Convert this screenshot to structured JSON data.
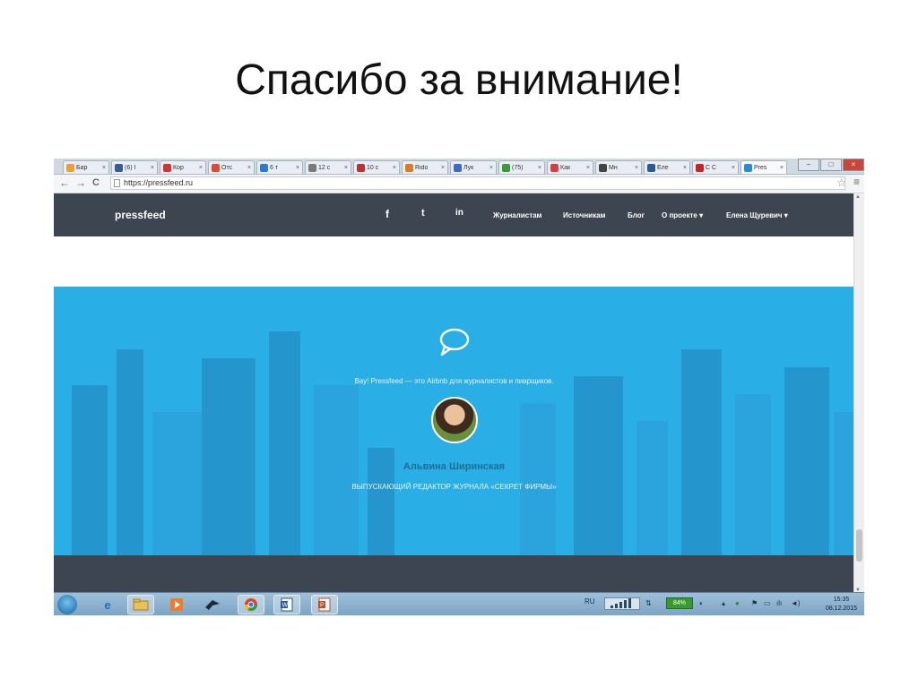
{
  "slide": {
    "title": "Спасибо за внимание!"
  },
  "browser": {
    "tabs": [
      {
        "label": "Бар",
        "color": "#f0a030"
      },
      {
        "label": "(6) I",
        "color": "#3b5998"
      },
      {
        "label": "Кор",
        "color": "#d9342b"
      },
      {
        "label": "Отс",
        "color": "#e04a2a"
      },
      {
        "label": "6 т",
        "color": "#2a7ad9"
      },
      {
        "label": "12 с",
        "color": "#7a7a7a"
      },
      {
        "label": "10 с",
        "color": "#c03030"
      },
      {
        "label": "Rido",
        "color": "#e07a20"
      },
      {
        "label": "Лук",
        "color": "#3a6ad9"
      },
      {
        "label": "(75)",
        "color": "#3a9a3a"
      },
      {
        "label": "Как",
        "color": "#d94040"
      },
      {
        "label": "Мн",
        "color": "#444444"
      },
      {
        "label": "Еле",
        "color": "#2a5a9a"
      },
      {
        "label": "С С",
        "color": "#cc2222"
      },
      {
        "label": "Pres",
        "color": "#2a8ad9"
      }
    ],
    "tab_close": "×",
    "url": "https://pressfeed.ru",
    "back_glyph": "←",
    "forward_glyph": "→",
    "reload_glyph": "C",
    "star_glyph": "☆",
    "menu_glyph": "≡"
  },
  "site": {
    "logo": "pressfeed",
    "social": {
      "facebook": "f",
      "twitter": "t",
      "linkedin": "in"
    },
    "nav": [
      "Журналистам",
      "Источникам",
      "Блог",
      "О проекте ▾",
      "Елена Щуревич ▾"
    ],
    "quote": "Вау! Pressfeed — это Airbnb для журналистов и пиарщиков.",
    "person_name": "Альвина Ширинская",
    "person_role": "ВЫПУСКАЮЩИЙ РЕДАКТОР ЖУРНАЛА «СЕКРЕТ ФИРМЫ»"
  },
  "taskbar": {
    "apps": [
      "ie-icon",
      "folder-icon",
      "media-player-icon",
      "bird-icon",
      "chrome-icon",
      "word-icon",
      "powerpoint-icon"
    ],
    "language": "RU",
    "battery": "84%",
    "time": "15:35",
    "date": "08.12.2015"
  }
}
